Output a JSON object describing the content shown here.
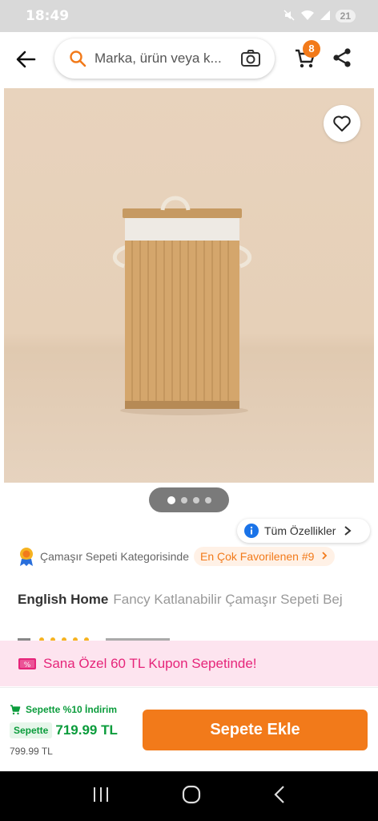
{
  "status_bar": {
    "time": "18:49",
    "battery": "21"
  },
  "header": {
    "search_placeholder": "Marka, ürün veya k...",
    "cart_count": "8"
  },
  "gallery": {
    "dots": 4,
    "active_index": 0
  },
  "specs_button": {
    "label": "Tüm Özellikler"
  },
  "category": {
    "text": "Çamaşır Sepeti Kategorisinde",
    "rank_label": "En Çok Favorilenen #9"
  },
  "product": {
    "brand": "English Home",
    "title": "Fancy Katlanabilir Çamaşır Sepeti Bej"
  },
  "coupon": {
    "text": "Sana Özel 60 TL Kupon Sepetinde!"
  },
  "purchase": {
    "discount_text": "Sepette %10 İndirim",
    "cart_price_label": "Sepette",
    "price": "719.99 TL",
    "old_price": "799.99 TL",
    "add_to_cart_label": "Sepete Ekle"
  },
  "colors": {
    "accent": "#f27a1a",
    "discount_green": "#0b9c3c",
    "coupon_pink": "#e6257a"
  },
  "icons": [
    "back-arrow-icon",
    "search-icon",
    "camera-icon",
    "cart-icon",
    "share-icon",
    "heart-icon",
    "info-icon",
    "chevron-right-icon",
    "award-badge-icon",
    "coupon-icon",
    "cart-small-icon",
    "nav-recents-icon",
    "nav-home-icon",
    "nav-back-icon"
  ]
}
